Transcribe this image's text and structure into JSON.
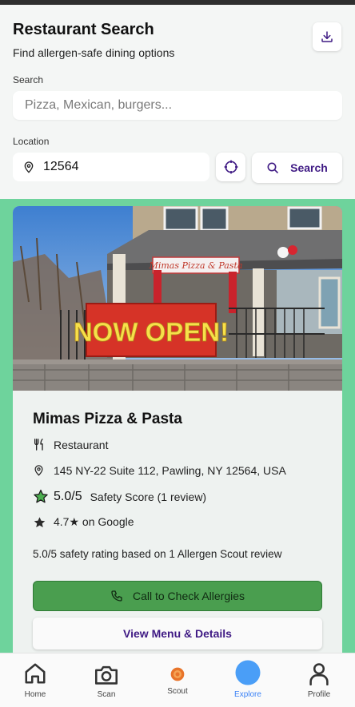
{
  "header": {
    "title": "Restaurant Search",
    "subtitle": "Find allergen-safe dining options",
    "download_icon": "download-icon"
  },
  "search": {
    "label": "Search",
    "placeholder": "Pizza, Mexican, burgers..."
  },
  "location": {
    "label": "Location",
    "value": "12564",
    "search_button": "Search"
  },
  "result": {
    "photo_banner_text": "NOW OPEN!",
    "photo_sign_text": "Mimas Pizza & Pasta",
    "name": "Mimas Pizza & Pasta",
    "category": "Restaurant",
    "address": "145 NY-22 Suite 112, Pawling, NY 12564, USA",
    "safety_score": "5.0/5",
    "safety_label": "Safety Score (1 review)",
    "google_rating": "4.7★ on Google",
    "summary": "5.0/5 safety rating based on 1 Allergen Scout review",
    "call_button": "Call to Check Allergies",
    "menu_button": "View Menu & Details"
  },
  "nav": {
    "items": [
      {
        "label": "Home",
        "icon": "home-icon"
      },
      {
        "label": "Scan",
        "icon": "camera-icon"
      },
      {
        "label": "Scout",
        "icon": "scout-icon"
      },
      {
        "label": "Explore",
        "icon": "explore-icon"
      },
      {
        "label": "Profile",
        "icon": "profile-icon"
      }
    ],
    "active": "Explore"
  },
  "colors": {
    "background_green": "#6ed39c",
    "accent_purple": "#3f1a84",
    "call_green": "#4a9e4f",
    "explore_blue": "#4a9ef7",
    "star_green": "#4caf50"
  }
}
